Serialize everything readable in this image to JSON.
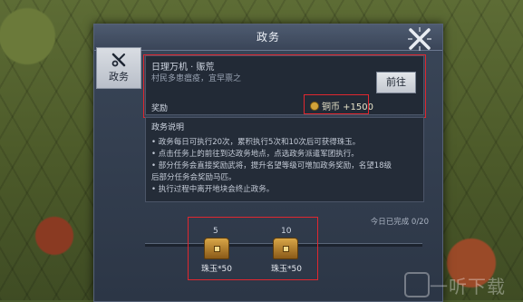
{
  "window": {
    "title": "政务"
  },
  "tab": {
    "label": "政务",
    "icon": "tools-icon"
  },
  "task": {
    "name": "日理万机 · 赈荒",
    "description": "村民多患瘟疫，宜早禀之",
    "reward_label": "奖励",
    "reward_amount": "铜币 +1500",
    "go_label": "前往"
  },
  "instructions": {
    "title": "政务说明",
    "lines": [
      "• 政务每日可执行20次，累积执行5次和10次后可获得珠玉。",
      "• 点击任务上的前往到达政务地点，点选政务派遣军团执行。",
      "• 部分任务会直接奖励武将，提升名望等级可增加政务奖励，名望18级",
      "  后部分任务会奖励马匹。",
      "• 执行过程中离开地块会终止政务。"
    ]
  },
  "progress": {
    "text": "今日已完成 0/20",
    "completed": 0,
    "total": 20
  },
  "milestones": [
    {
      "count": "5",
      "reward": "珠玉*50"
    },
    {
      "count": "10",
      "reward": "珠玉*50"
    }
  ],
  "watermark": {
    "text": "一听下载"
  },
  "colors": {
    "highlight": "#e0272f",
    "panel": "#2c3646",
    "accent": "#d2a33a"
  }
}
